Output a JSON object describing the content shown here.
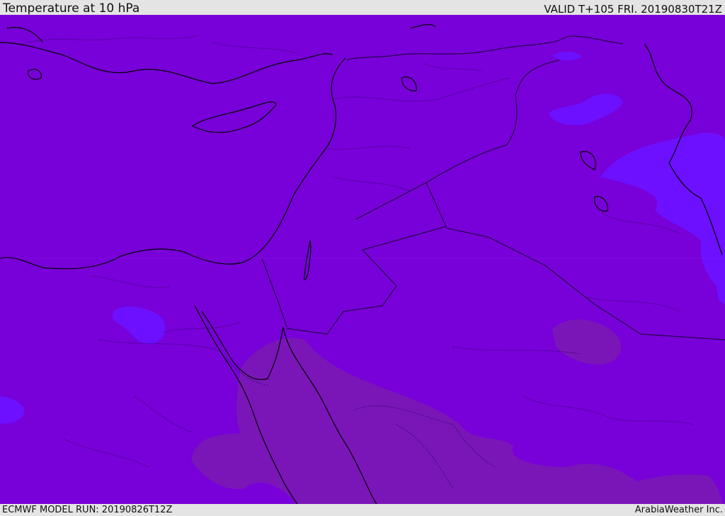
{
  "header": {
    "title": "Temperature at 10 hPa",
    "valid": "VALID T+105 FRI. 20190830T21Z"
  },
  "footer": {
    "model_run": "ECMWF MODEL RUN: 20190826T12Z",
    "credit": "ArabiaWeather Inc."
  },
  "colors": {
    "base_field": "#7800d8",
    "cool_patch": "#6a10ff",
    "warm_patch": "#7a16b8",
    "coastline": "#000000",
    "border": "#1a0040"
  }
}
